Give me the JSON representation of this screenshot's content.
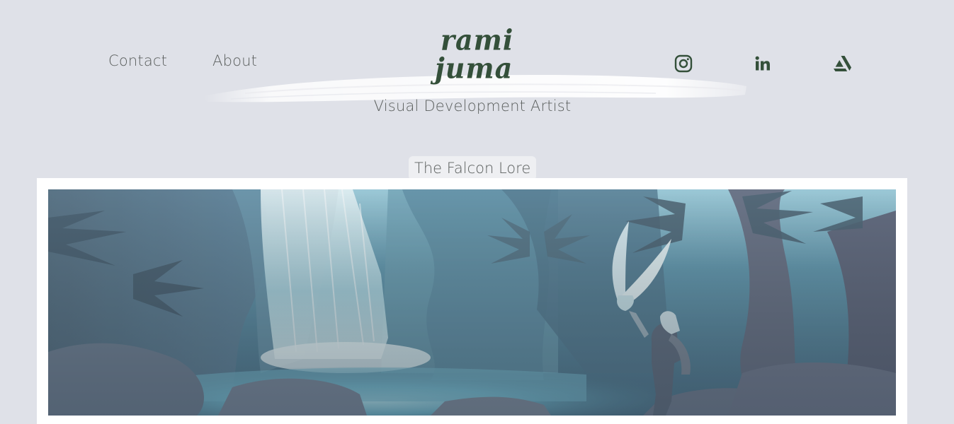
{
  "nav": {
    "contact_label": "Contact",
    "about_label": "About"
  },
  "logo": {
    "line1": "rami",
    "line2": "juma"
  },
  "subtitle": "Visual Development Artist",
  "social": {
    "icons": [
      "instagram-icon",
      "linkedin-icon",
      "artstation-icon"
    ],
    "icon_color": "#34503a"
  },
  "project": {
    "title": "The Falcon Lore"
  },
  "colors": {
    "background": "#dfe1e8",
    "text": "#5b5f5e",
    "brand": "#34503a",
    "frame": "#ffffff"
  }
}
